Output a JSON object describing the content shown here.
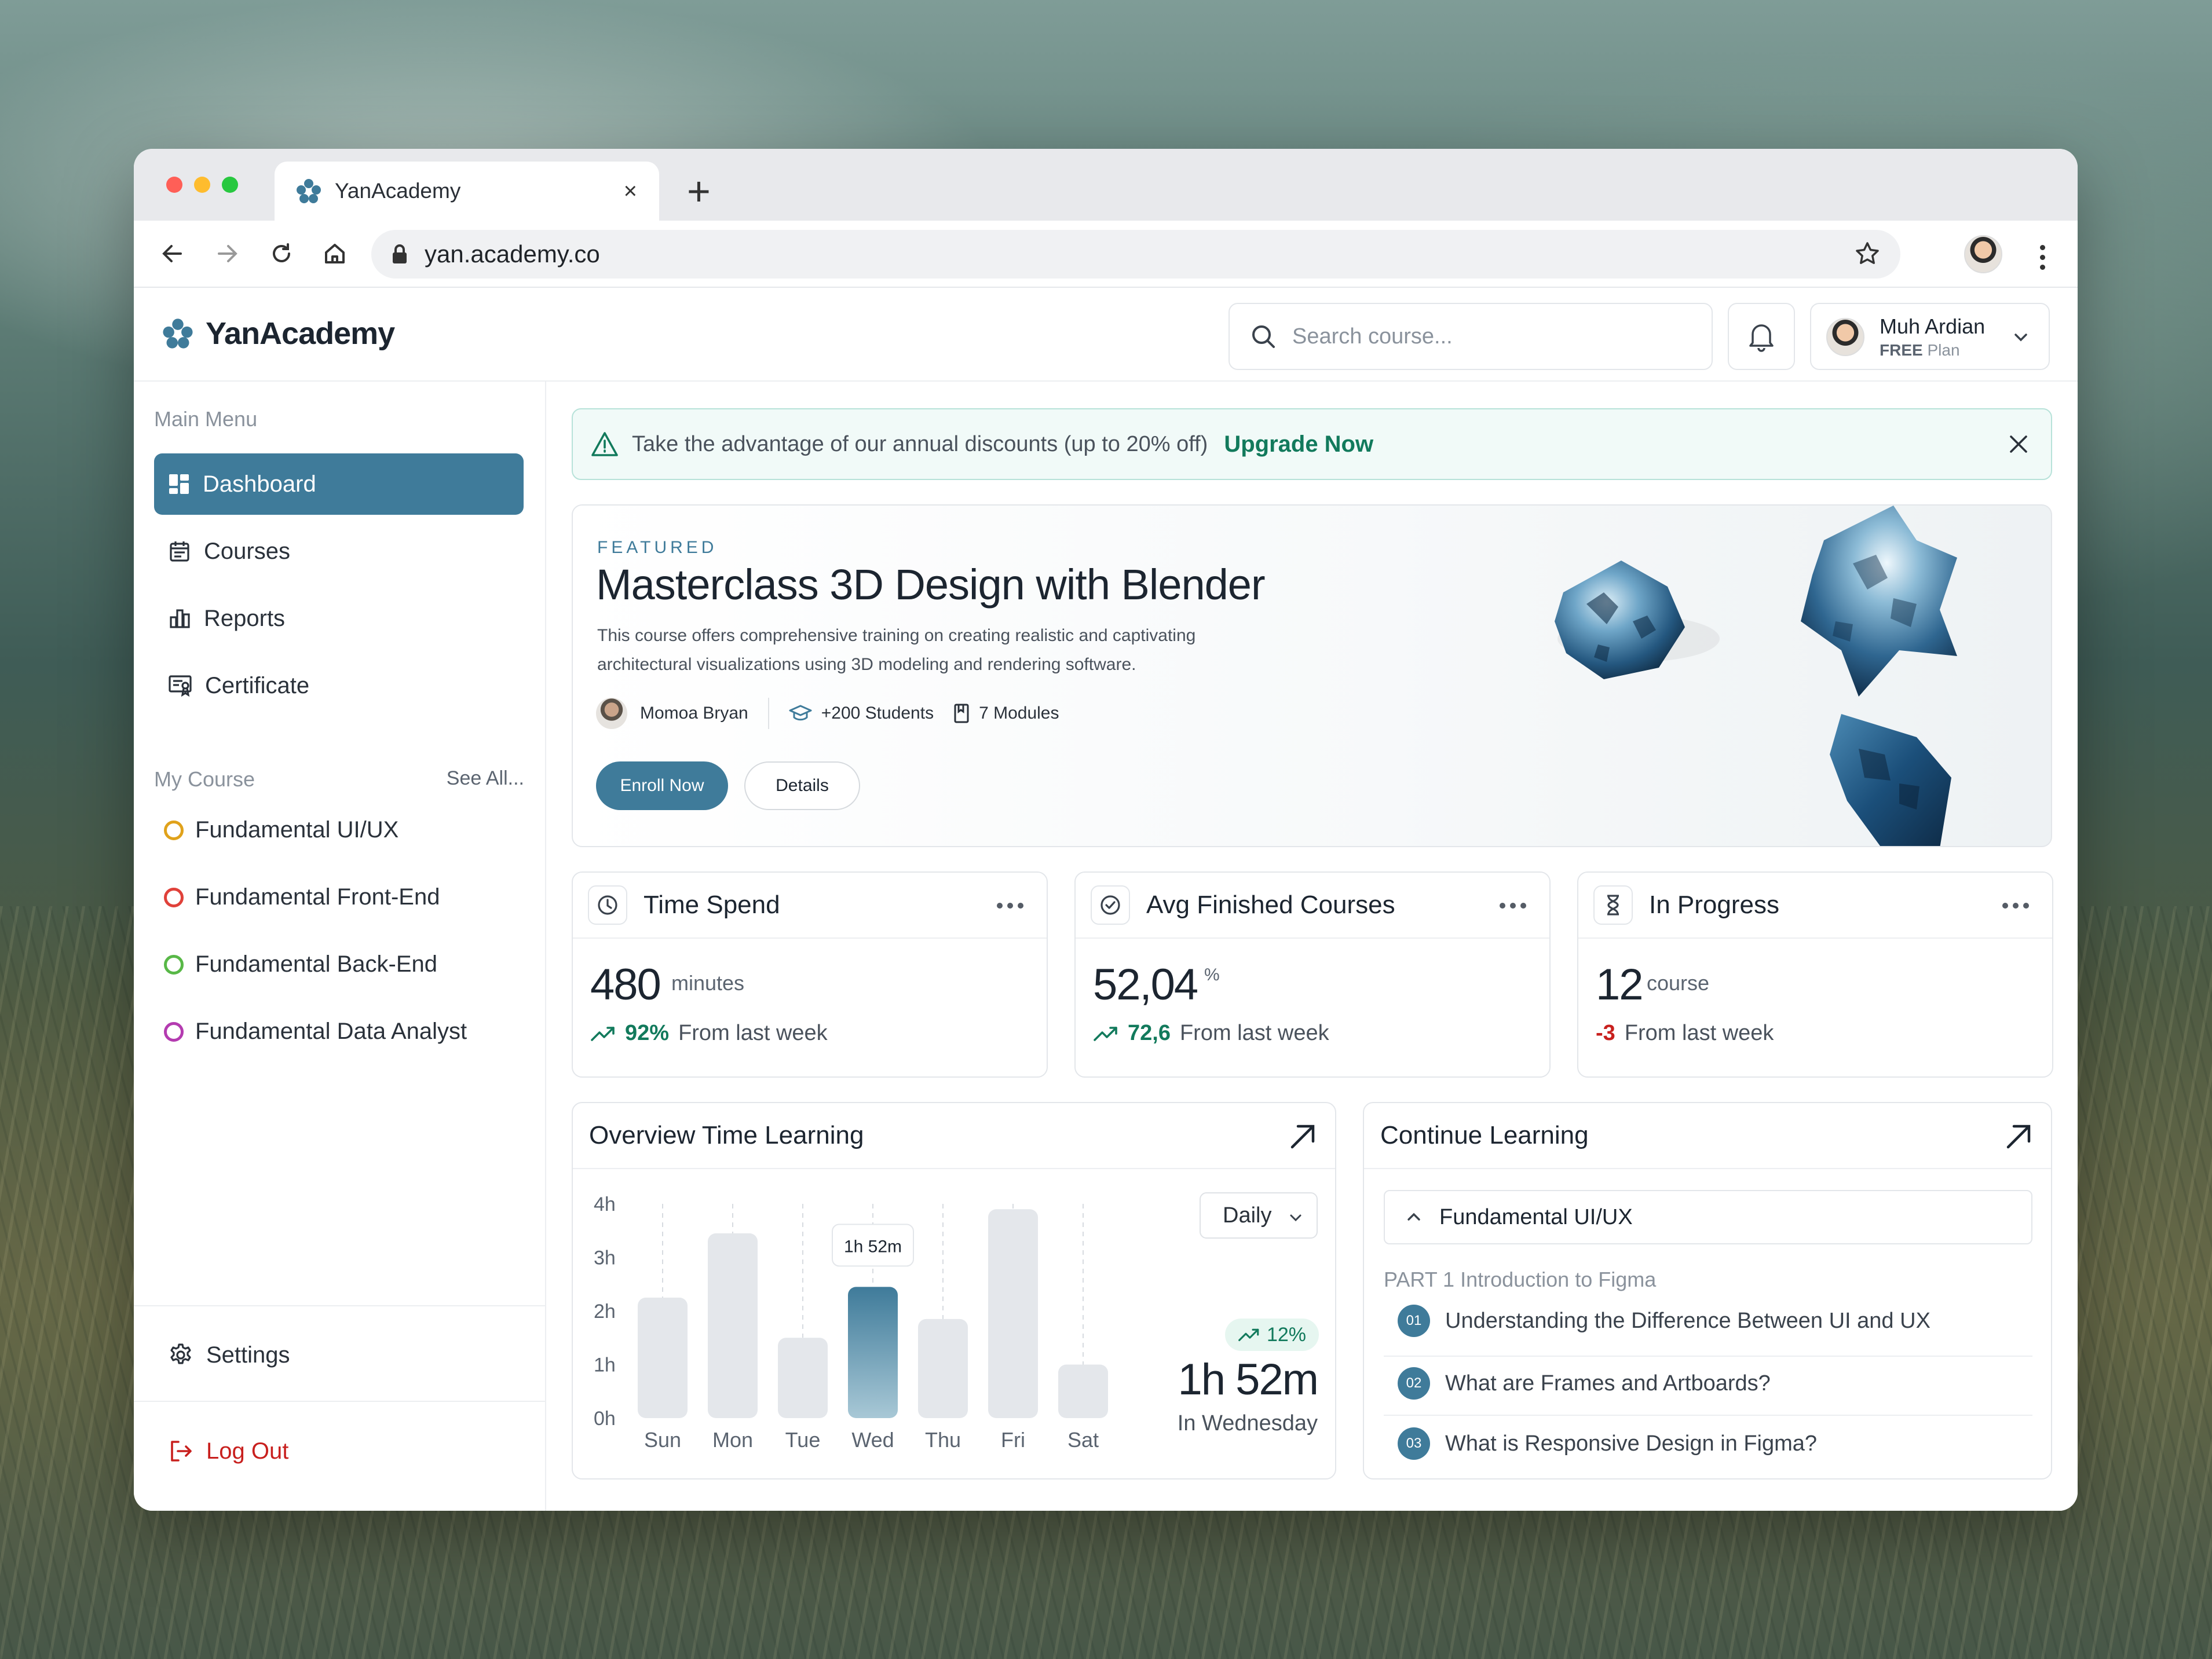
{
  "browser": {
    "tab_title": "YanAcademy",
    "tab_close": "×",
    "new_tab": "+",
    "url": "yan.academy.co",
    "traffic_colors": [
      "#ff5f57",
      "#febc2e",
      "#28c840"
    ]
  },
  "header": {
    "logo_text": "YanAcademy",
    "search_placeholder": "Search course...",
    "user": {
      "name": "Muh Ardian",
      "plan_badge": "FREE",
      "plan_label": "Plan"
    }
  },
  "sidebar": {
    "main_menu_label": "Main Menu",
    "items": [
      {
        "label": "Dashboard",
        "icon": "dashboard-icon",
        "active": true
      },
      {
        "label": "Courses",
        "icon": "calendar-icon",
        "active": false
      },
      {
        "label": "Reports",
        "icon": "bar-chart-icon",
        "active": false
      },
      {
        "label": "Certificate",
        "icon": "certificate-icon",
        "active": false
      }
    ],
    "my_course_label": "My Course",
    "see_all": "See All...",
    "courses": [
      {
        "label": "Fundamental UI/UX",
        "color": "#e0a21b"
      },
      {
        "label": "Fundamental Front-End",
        "color": "#e0413a"
      },
      {
        "label": "Fundamental Back-End",
        "color": "#58b847"
      },
      {
        "label": "Fundamental Data Analyst",
        "color": "#b43bb0"
      }
    ],
    "settings": "Settings",
    "logout": "Log Out"
  },
  "banner": {
    "text": "Take the advantage of our annual discounts (up to 20% off)",
    "link": "Upgrade Now"
  },
  "featured": {
    "eyebrow": "FEATURED",
    "title": "Masterclass 3D Design with Blender",
    "description": "This course offers comprehensive training on creating realistic and captivating architectural visualizations using 3D modeling and rendering software.",
    "instructor": "Momoa Bryan",
    "students": "+200 Students",
    "modules": "7 Modules",
    "enroll": "Enroll Now",
    "details": "Details"
  },
  "stats": [
    {
      "title": "Time Spend",
      "value": "480",
      "unit": "minutes",
      "trend": "92%",
      "trend_dir": "up",
      "note": "From last week"
    },
    {
      "title": "Avg Finished Courses",
      "value": "52,04",
      "unit": "%",
      "trend": "72,6",
      "trend_dir": "up",
      "note": "From last week"
    },
    {
      "title": "In Progress",
      "value": "12",
      "unit": "course",
      "trend": "-3",
      "trend_dir": "down",
      "note": "From last week"
    }
  ],
  "overview": {
    "title": "Overview Time Learning",
    "period": "Daily",
    "change": "12%",
    "highlight_value": "1h 52m",
    "highlight_day": "In Wednesday"
  },
  "chart_data": {
    "type": "bar",
    "categories": [
      "Sun",
      "Mon",
      "Tue",
      "Wed",
      "Thu",
      "Fri",
      "Sat"
    ],
    "values": [
      2.25,
      3.45,
      1.5,
      2.45,
      1.85,
      3.9,
      1.0
    ],
    "highlight_index": 3,
    "tooltip": "1h 52m",
    "yticks": [
      "4h",
      "3h",
      "2h",
      "1h",
      "0h"
    ],
    "ylim": [
      0,
      4
    ],
    "colors": {
      "bar": "#e4e7eb",
      "highlight_top": "#3f7b9a",
      "highlight_bottom": "#a8c8d6"
    }
  },
  "continue": {
    "title": "Continue Learning",
    "course": "Fundamental UI/UX",
    "part": "PART 1  Introduction to Figma",
    "lessons": [
      {
        "num": "01",
        "title": "Understanding the Difference Between UI and UX"
      },
      {
        "num": "02",
        "title": "What are Frames and Artboards?"
      },
      {
        "num": "03",
        "title": "What is Responsive Design in Figma?"
      }
    ]
  },
  "colors": {
    "accent": "#3f7b9a",
    "positive": "#127a5c",
    "negative": "#c8201e"
  }
}
